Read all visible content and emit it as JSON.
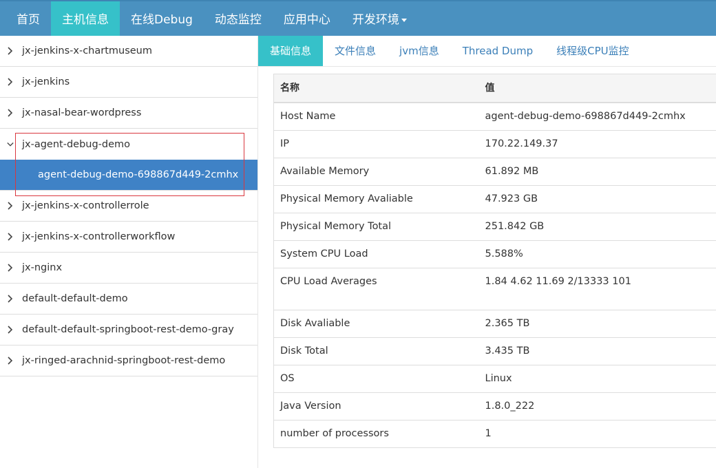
{
  "nav": {
    "items": [
      {
        "label": "首页"
      },
      {
        "label": "主机信息"
      },
      {
        "label": "在线Debug"
      },
      {
        "label": "动态监控"
      },
      {
        "label": "应用中心"
      },
      {
        "label": "开发环境"
      }
    ],
    "active_index": 1
  },
  "tree": {
    "items": [
      {
        "label": "jx-jenkins-x-chartmuseum"
      },
      {
        "label": "jx-jenkins"
      },
      {
        "label": "jx-nasal-bear-wordpress"
      },
      {
        "label": "jx-agent-debug-demo",
        "child": "agent-debug-demo-698867d449-2cmhx"
      },
      {
        "label": "jx-jenkins-x-controllerrole"
      },
      {
        "label": "jx-jenkins-x-controllerworkflow"
      },
      {
        "label": "jx-nginx"
      },
      {
        "label": "default-default-demo"
      },
      {
        "label": "default-default-springboot-rest-demo-gray"
      },
      {
        "label": "jx-ringed-arachnid-springboot-rest-demo"
      }
    ],
    "highlight_color": "#d9363e"
  },
  "tabs": {
    "items": [
      {
        "label": "基础信息"
      },
      {
        "label": "文件信息"
      },
      {
        "label": "jvm信息"
      },
      {
        "label": "Thread Dump"
      },
      {
        "label": "线程级CPU监控"
      }
    ],
    "active_index": 0
  },
  "table": {
    "headers": {
      "name": "名称",
      "value": "值"
    },
    "rows": [
      {
        "name": "Host Name",
        "value": "agent-debug-demo-698867d449-2cmhx"
      },
      {
        "name": "IP",
        "value": "170.22.149.37"
      },
      {
        "name": "Available Memory",
        "value": "61.892 MB"
      },
      {
        "name": "Physical Memory Avaliable",
        "value": "47.923 GB"
      },
      {
        "name": "Physical Memory Total",
        "value": "251.842 GB"
      },
      {
        "name": "System CPU Load",
        "value": "5.588%"
      },
      {
        "name": "CPU Load Averages",
        "value": "1.84 4.62 11.69 2/13333 101"
      },
      {
        "name": "Disk Avaliable",
        "value": "2.365 TB"
      },
      {
        "name": "Disk Total",
        "value": "3.435 TB"
      },
      {
        "name": "OS",
        "value": "Linux"
      },
      {
        "name": "Java Version",
        "value": "1.8.0_222"
      },
      {
        "name": "number of processors",
        "value": "1"
      }
    ]
  },
  "colors": {
    "nav_bg": "#4a91c0",
    "accent": "#36c1c9",
    "selected_child": "#3f82c6",
    "link": "#3b7fb8"
  }
}
